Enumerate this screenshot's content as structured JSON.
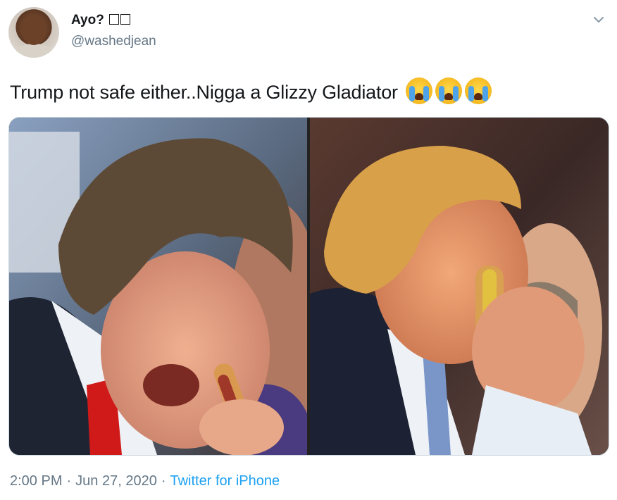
{
  "author": {
    "name": "Ayo? ",
    "handle": "@washedjean"
  },
  "tweet": {
    "text": "Trump not safe either..Nigga a Glizzy Gladiator",
    "emojis": [
      "loudly-crying-face-emoji",
      "loudly-crying-face-emoji",
      "loudly-crying-face-emoji"
    ]
  },
  "media": {
    "photos": [
      {
        "name": "left-photo"
      },
      {
        "name": "right-photo"
      }
    ]
  },
  "meta": {
    "time": "2:00 PM",
    "date": "Jun 27, 2020",
    "separator": "·",
    "source": "Twitter for iPhone"
  },
  "colors": {
    "link": "#1da1f2",
    "secondary_text": "#657786",
    "primary_text": "#14171a"
  }
}
